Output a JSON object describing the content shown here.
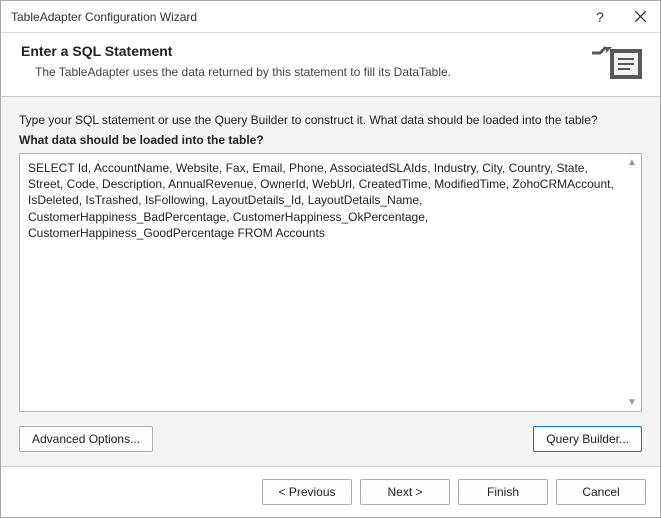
{
  "titlebar": {
    "title": "TableAdapter Configuration Wizard"
  },
  "header": {
    "heading": "Enter a SQL Statement",
    "subtext": "The TableAdapter uses the data returned by this statement to fill its DataTable."
  },
  "body": {
    "instruction": "Type your SQL statement or use the Query Builder to construct it. What data should be loaded into the table?",
    "prompt": "What data should be loaded into the table?",
    "sql": "SELECT Id, AccountName, Website, Fax, Email, Phone, AssociatedSLAIds, Industry, City, Country, State, Street, Code, Description, AnnualRevenue, OwnerId, WebUrl, CreatedTime, ModifiedTime, ZohoCRMAccount, IsDeleted, IsTrashed, IsFollowing, LayoutDetails_Id, LayoutDetails_Name, CustomerHappiness_BadPercentage, CustomerHappiness_OkPercentage, CustomerHappiness_GoodPercentage FROM Accounts"
  },
  "buttons": {
    "advanced": "Advanced Options...",
    "query_builder": "Query Builder...",
    "previous": "< Previous",
    "next": "Next >",
    "finish": "Finish",
    "cancel": "Cancel"
  }
}
